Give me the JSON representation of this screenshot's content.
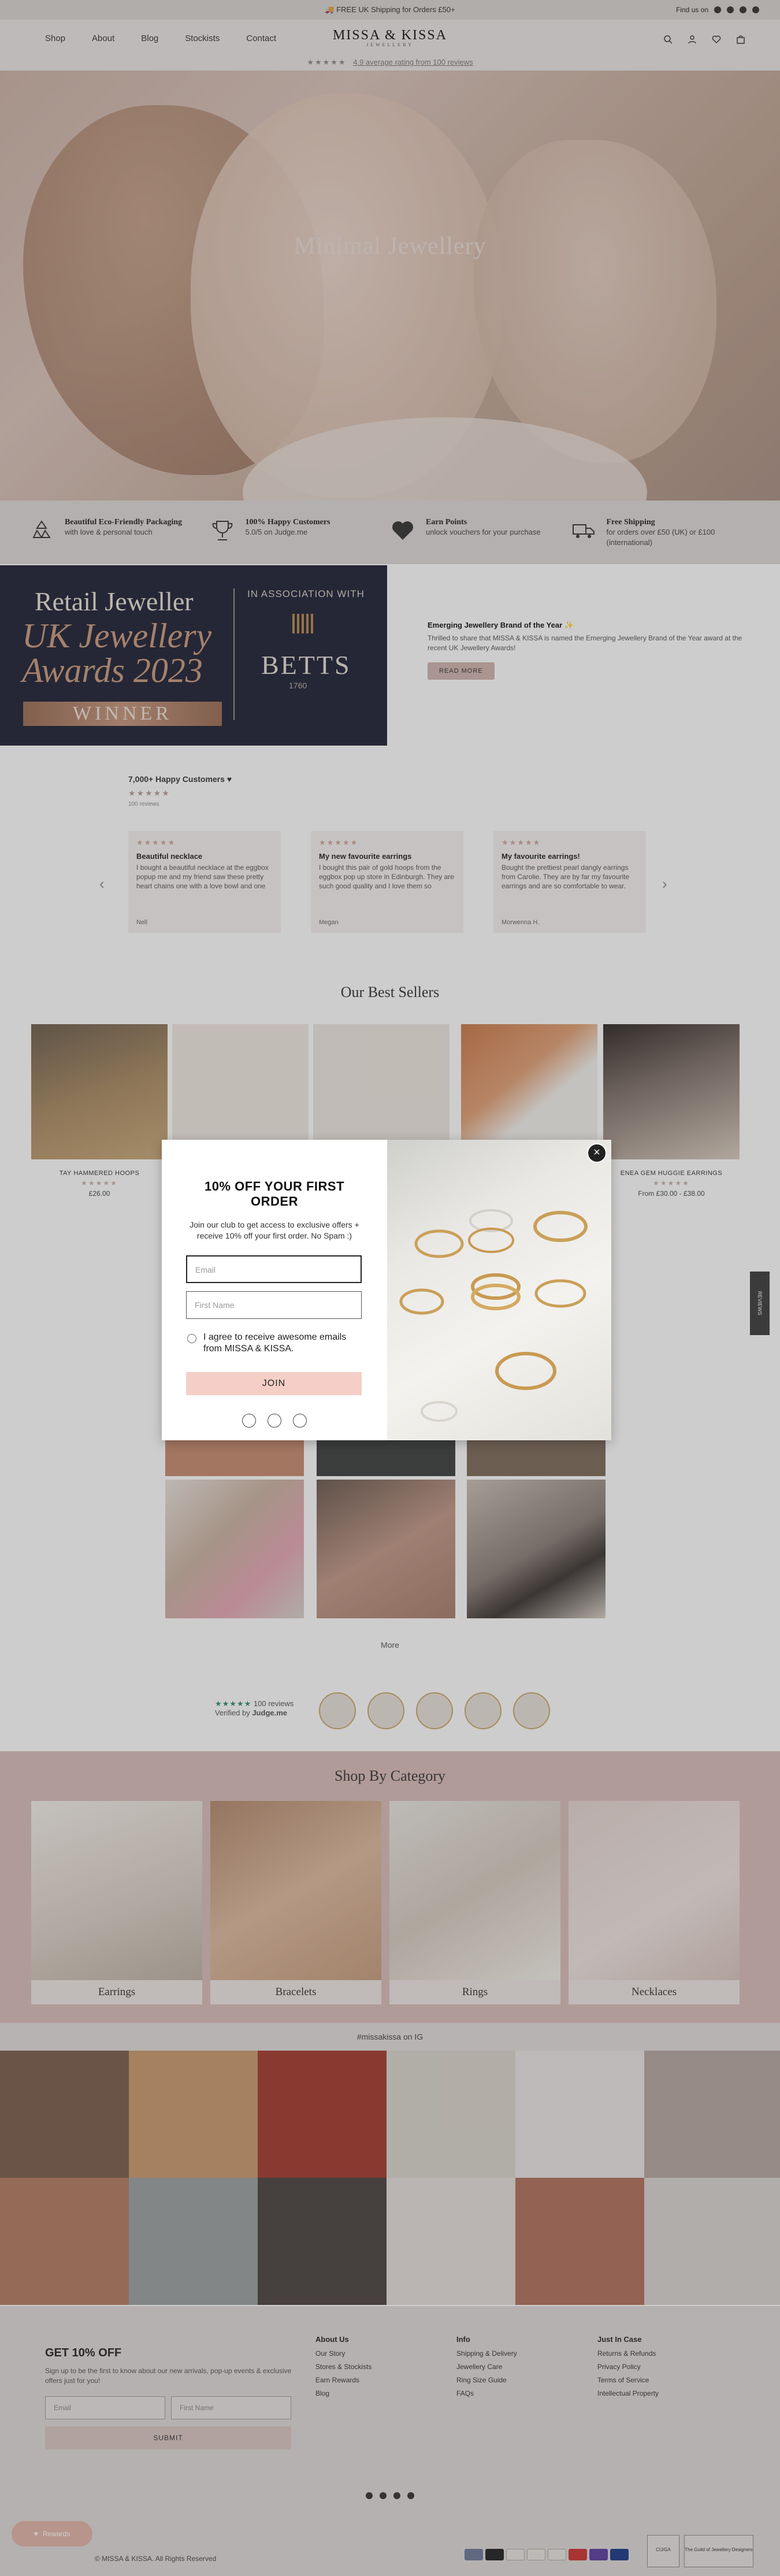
{
  "announcement": {
    "text": "🚚 FREE UK Shipping for Orders £50+",
    "find_us": "Find us on"
  },
  "header": {
    "nav": [
      "Shop",
      "About",
      "Blog",
      "Stockists",
      "Contact"
    ],
    "logo": "MISSA & KISSA",
    "logo_sub": "JEWELLERY",
    "stars": "★★★★★",
    "rating_text": "4.9 average rating from 100 reviews"
  },
  "hero": {
    "title": "Minimal Jewellery"
  },
  "features": [
    {
      "title": "Beautiful Eco-Friendly Packaging",
      "text": "with love & personal touch"
    },
    {
      "title": "100% Happy Customers",
      "text": "5.0/5 on Judge.me"
    },
    {
      "title": "Earn Points",
      "text": "unlock vouchers for your purchase"
    },
    {
      "title": "Free Shipping",
      "text": "for orders over £50 (UK) or £100 (international)"
    }
  ],
  "award": {
    "line1": "Retail Jeweller",
    "line2": "UK Jewellery",
    "line3": "Awards 2023",
    "winner": "WINNER",
    "assoc": "IN ASSOCIATION WITH",
    "betts": "BETTS",
    "est": "1760",
    "headline": "Emerging Jewellery Brand of the Year ✨",
    "body": "Thrilled to share that MISSA & KISSA is named the Emerging Jewellery Brand of the Year award at the recent UK Jewellery Awards!",
    "button": "READ MORE"
  },
  "reviews": {
    "title": "7,000+ Happy Customers ♥",
    "stars": "★★★★★",
    "count": "100 reviews",
    "items": [
      {
        "title": "Beautiful necklace",
        "text": "I bought a beautiful necklace at the eggbox popup me and my friend saw these pretty heart chains one with a love bowl and one with pick...",
        "name": "Nell"
      },
      {
        "title": "My new favourite earrings",
        "text": "I bought this pair of gold hoops from the eggbox pop up store in Edinburgh. They are such good quality and I love them so much...",
        "name": "Megan"
      },
      {
        "title": "My favourite earrings!",
        "text": "Bought the prettiest pearl dangly earrings from Carolie. They are by far my favourite earrings and are so comfortable to wear. I've worn the...",
        "name": "Morwenna H."
      }
    ]
  },
  "best_sellers": {
    "title": "Our Best Sellers",
    "products": [
      {
        "name": "TAY HAMMERED HOOPS",
        "stars": "★★★★★",
        "price": "£26.00"
      },
      {
        "name": "",
        "stars": "",
        "price": ""
      },
      {
        "name": "",
        "stars": "",
        "price": ""
      },
      {
        "name": "",
        "stars": "",
        "price": ""
      },
      {
        "name": "ENEA GEM HUGGIE EARRINGS",
        "stars": "★★★★★",
        "price": "From £30.00 - £38.00"
      }
    ]
  },
  "more": "More",
  "judge": {
    "stars": "★★★★★",
    "reviews": "100 reviews",
    "verified": "Verified by",
    "brand": "Judge.me"
  },
  "categories": {
    "title": "Shop By Category",
    "items": [
      "Earrings",
      "Bracelets",
      "Rings",
      "Necklaces"
    ]
  },
  "instagram": {
    "title": "#missakissa on IG"
  },
  "footer": {
    "newsletter_title": "GET 10% OFF",
    "newsletter_text": "Sign up to be the first to know about our new arrivals, pop-up events & exclusive offers just for you!",
    "email_placeholder": "Email",
    "name_placeholder": "First Name",
    "submit": "SUBMIT",
    "columns": [
      {
        "title": "About Us",
        "links": [
          "Our Story",
          "Stores & Stockists",
          "Earn Rewards",
          "Blog"
        ]
      },
      {
        "title": "Info",
        "links": [
          "Shipping & Delivery",
          "Jewellery Care",
          "Ring Size Guide",
          "FAQs"
        ]
      },
      {
        "title": "Just In Case",
        "links": [
          "Returns & Refunds",
          "Privacy Policy",
          "Terms of Service",
          "Intellectual Property"
        ]
      }
    ],
    "copyright": "© MISSA & KISSA. All Rights Reserved",
    "chat": "Rewards",
    "badges": [
      "CIJ/GA",
      "The Guild of Jewellery Designers"
    ]
  },
  "side_tab": "REVIEWS",
  "modal": {
    "title": "10% OFF YOUR FIRST ORDER",
    "desc": "Join our club to get access to exclusive offers + receive 10% off your first order. No Spam :)",
    "email_placeholder": "Email",
    "name_placeholder": "First Name",
    "consent": "I agree to receive awesome emails from MISSA & KISSA.",
    "join": "JOIN",
    "close": "×"
  }
}
